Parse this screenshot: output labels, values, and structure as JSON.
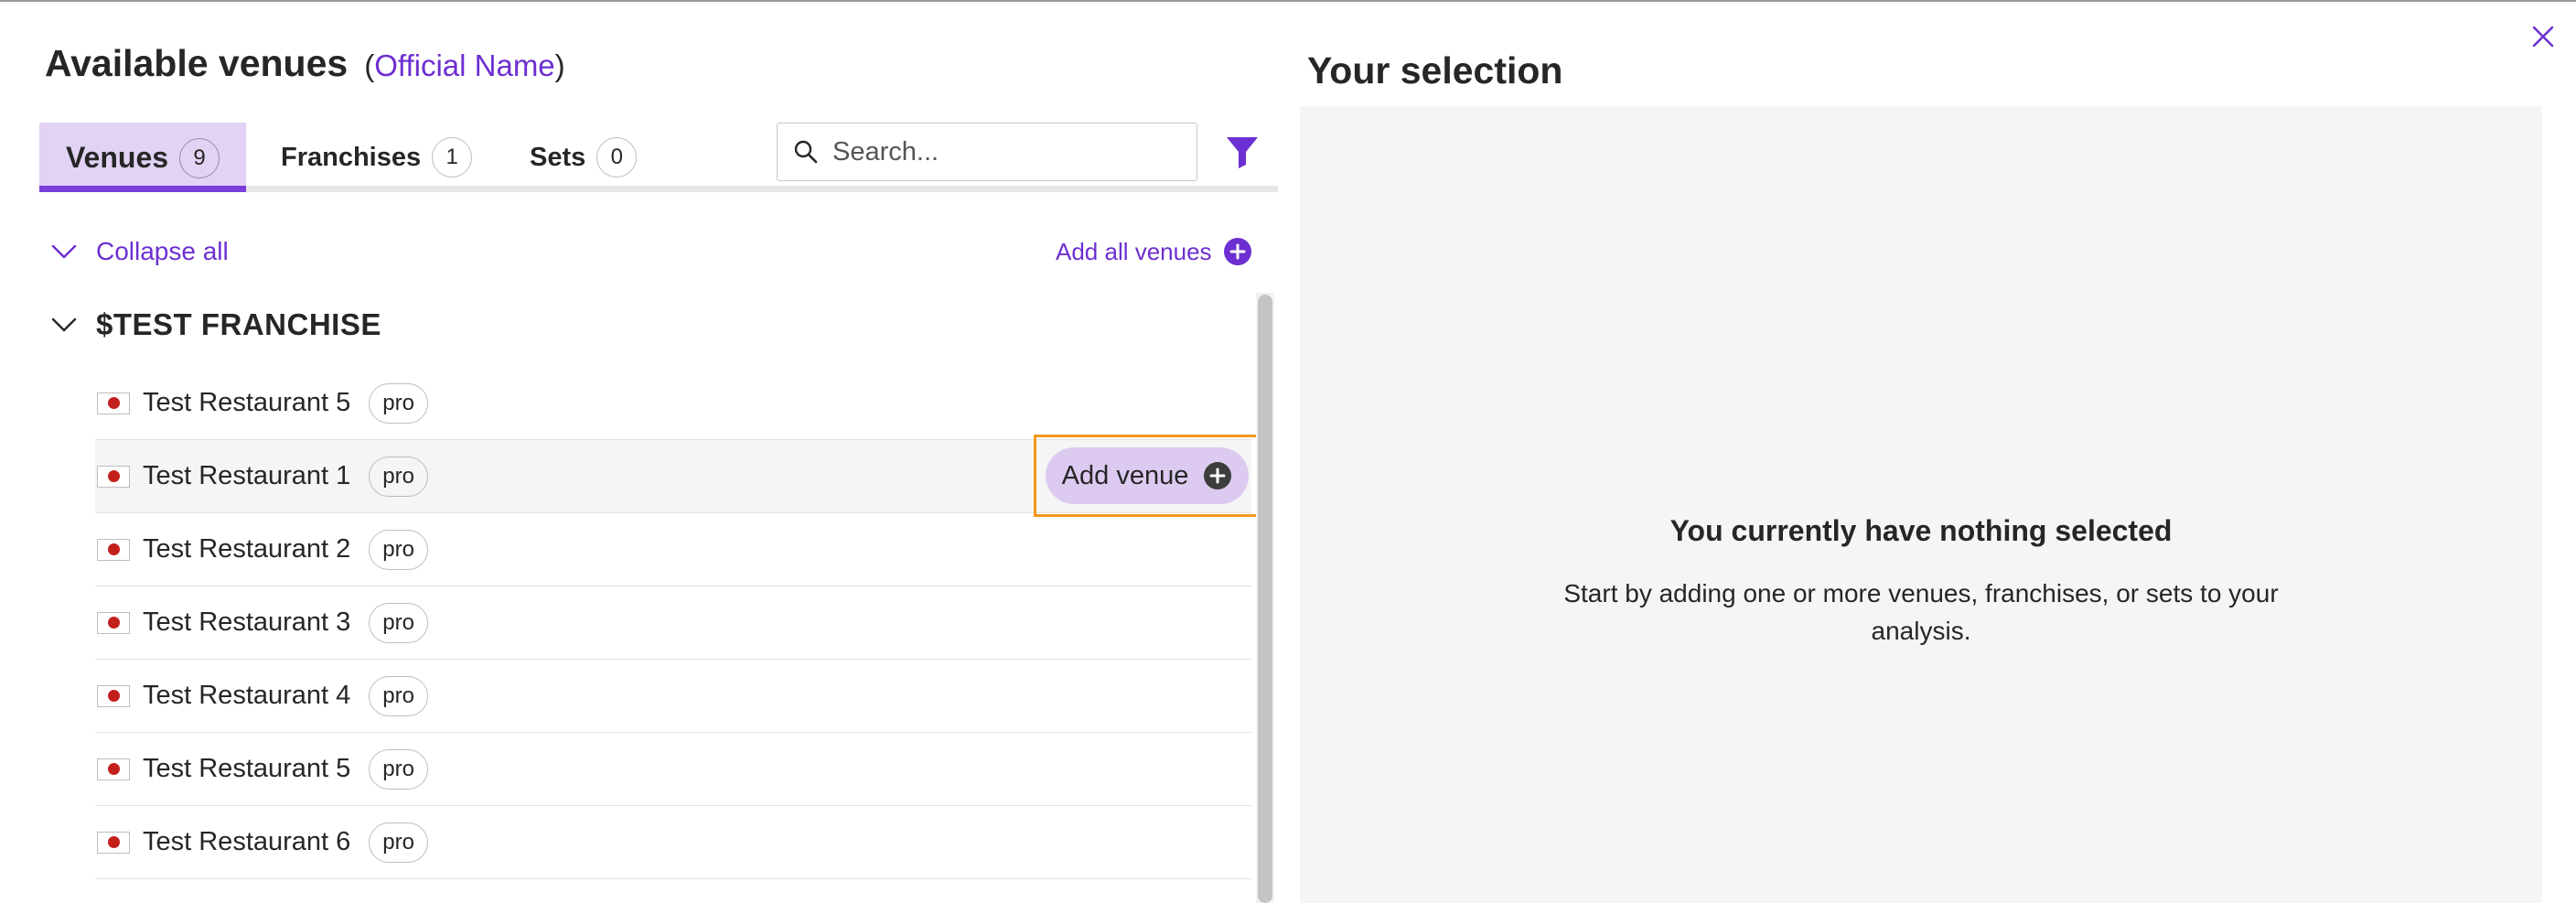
{
  "header": {
    "title": "Available venues",
    "subtitle_open": "(",
    "subtitle_link": "Official Name",
    "subtitle_close": ")"
  },
  "tabs": [
    {
      "label": "Venues",
      "count": "9",
      "active": true
    },
    {
      "label": "Franchises",
      "count": "1",
      "active": false
    },
    {
      "label": "Sets",
      "count": "0",
      "active": false
    }
  ],
  "search": {
    "placeholder": "Search...",
    "value": ""
  },
  "actions": {
    "collapse_all": "Collapse all",
    "add_all": "Add all venues"
  },
  "group": {
    "title": "$TEST FRANCHISE"
  },
  "venues": [
    {
      "name": "Test Restaurant 5",
      "badge": "pro"
    },
    {
      "name": "Test Restaurant 1",
      "badge": "pro",
      "add_label": "Add venue"
    },
    {
      "name": "Test Restaurant 2",
      "badge": "pro"
    },
    {
      "name": "Test Restaurant 3",
      "badge": "pro"
    },
    {
      "name": "Test Restaurant 4",
      "badge": "pro"
    },
    {
      "name": "Test Restaurant 5",
      "badge": "pro"
    },
    {
      "name": "Test Restaurant 6",
      "badge": "pro"
    }
  ],
  "selection": {
    "title": "Your selection",
    "empty_title": "You currently have nothing selected",
    "empty_text": "Start by adding one or more venues, franchises, or sets to your analysis."
  },
  "colors": {
    "accent": "#6d2fd1",
    "active_tab_bg": "#e2d2f4",
    "highlight_border": "#f2961e",
    "flag_dot": "#c3201c"
  },
  "icons": {
    "close": "close-icon",
    "search": "search-icon",
    "filter": "filter-icon",
    "chevron": "chevron-down-icon",
    "plus": "plus-circle-icon",
    "flag": "flag-icon"
  }
}
